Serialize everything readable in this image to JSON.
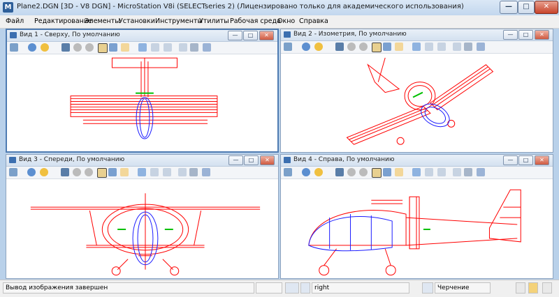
{
  "window": {
    "title": "Plane2.DGN [3D - V8 DGN] - MicroStation V8i (SELECTseries 2) (Лицензировано только для академического использования)",
    "app_icon": "microstation-logo",
    "controls": {
      "minimize": "—",
      "maximize": "□",
      "close": "✕"
    }
  },
  "menu": [
    {
      "label": "Файл",
      "accel": "Ф"
    },
    {
      "label": "Редактирование",
      "accel": "Р"
    },
    {
      "label": "Элементы",
      "accel": "Э"
    },
    {
      "label": "Установки",
      "accel": "У"
    },
    {
      "label": "Инструменты",
      "accel": "И"
    },
    {
      "label": "Утилиты",
      "accel": "т"
    },
    {
      "label": "Рабочая среда",
      "accel": "Р"
    },
    {
      "label": "Окно",
      "accel": "О"
    },
    {
      "label": "Справка",
      "accel": "С"
    }
  ],
  "views": [
    {
      "title": "Вид 1 - Сверху, По умолчанию",
      "active": true
    },
    {
      "title": "Вид 2 - Изометрия, По умолчанию",
      "active": false
    },
    {
      "title": "Вид 3 - Спереди, По умолчанию",
      "active": false
    },
    {
      "title": "Вид 4 - Справа, По умолчанию",
      "active": false
    }
  ],
  "view_controls": {
    "minimize": "—",
    "maximize": "□",
    "close": "✕"
  },
  "status": {
    "message": "Вывод изображения завершен",
    "snap_mode": "right",
    "mode": "Черчение"
  },
  "colors": {
    "wire_red": "#ff0000",
    "wire_blue": "#1a1aff",
    "wire_green": "#00c000",
    "accent": "#4f7cb2"
  }
}
